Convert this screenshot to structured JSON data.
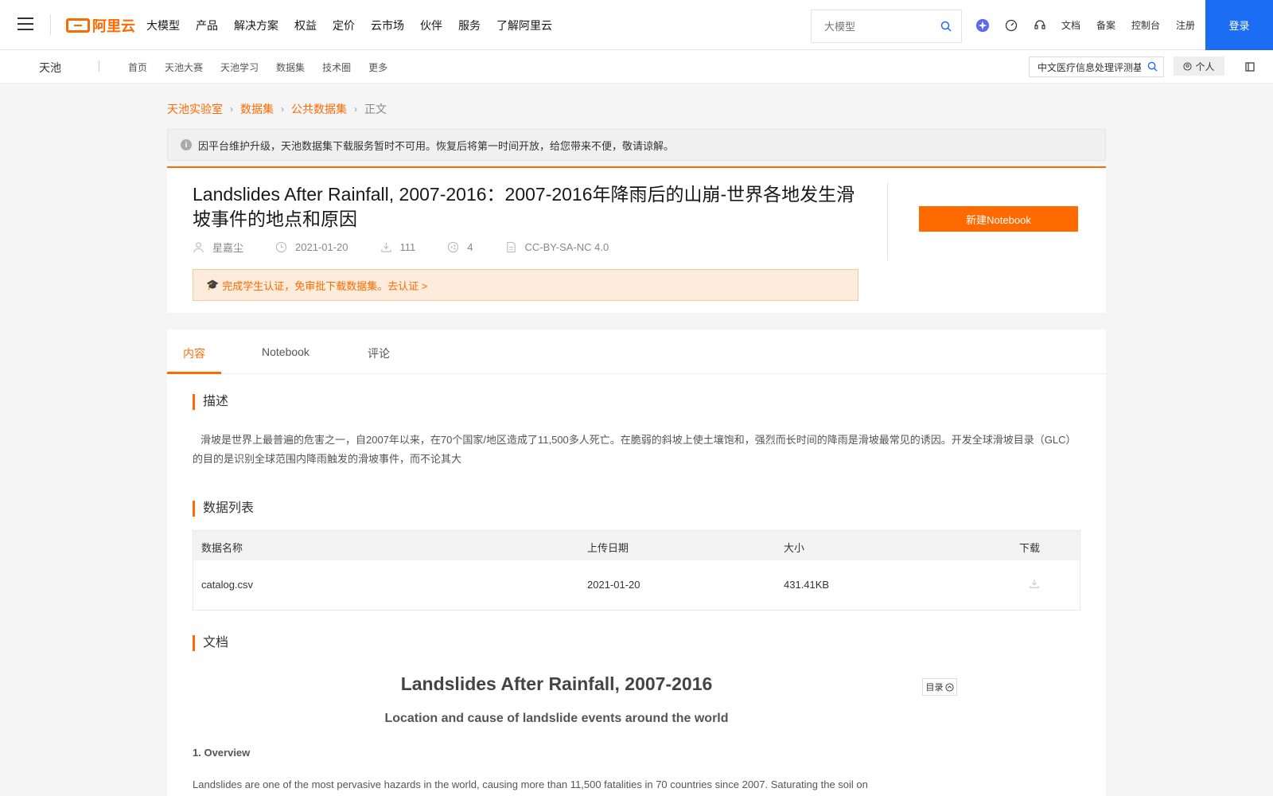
{
  "topnav": {
    "logo_text": "阿里云",
    "menu": [
      "大模型",
      "产品",
      "解决方案",
      "权益",
      "定价",
      "云市场",
      "伙伴",
      "服务",
      "了解阿里云"
    ],
    "search_placeholder": "大模型",
    "links": [
      "文档",
      "备案",
      "控制台",
      "注册"
    ],
    "login": "登录"
  },
  "subnav": {
    "brand": "天池",
    "items": [
      "首页",
      "天池大赛",
      "天池学习",
      "数据集",
      "技术圈",
      "更多"
    ],
    "search_value": "中文医疗信息处理评测基",
    "personal": "个人"
  },
  "breadcrumb": [
    "天池实验室",
    "数据集",
    "公共数据集",
    "正文"
  ],
  "notice": "因平台维护升级，天池数据集下载服务暂时不可用。恢复后将第一时间开放，给您带来不便，敬请谅解。",
  "dataset": {
    "title": "Landslides After Rainfall, 2007-2016：2007-2016年降雨后的山崩-世界各地发生滑坡事件的地点和原因",
    "author": "星嘉尘",
    "date": "2021-01-20",
    "downloads": "111",
    "shares": "4",
    "license": "CC-BY-SA-NC 4.0",
    "student_banner": "完成学生认证，免审批下载数据集。去认证 >",
    "new_notebook": "新建Notebook"
  },
  "tabs": [
    "内容",
    "Notebook",
    "评论"
  ],
  "sections": {
    "description_title": "描述",
    "description": "滑坡是世界上最普遍的危害之一，自2007年以来，在70个国家/地区造成了11,500多人死亡。在脆弱的斜坡上使土壤饱和，强烈而长时间的降雨是滑坡最常见的诱因。开发全球滑坡目录（GLC）的目的是识别全球范围内降雨触发的滑坡事件，而不论其大",
    "datalist_title": "数据列表",
    "docs_title": "文档"
  },
  "table": {
    "headers": [
      "数据名称",
      "上传日期",
      "大小",
      "下载"
    ],
    "rows": [
      {
        "name": "catalog.csv",
        "date": "2021-01-20",
        "size": "431.41KB"
      }
    ]
  },
  "doc": {
    "title": "Landslides After Rainfall, 2007-2016",
    "subtitle": "Location and cause of landslide events around the world",
    "toc": "目录",
    "h1": "1. Overview",
    "p1": "Landslides are one of the most pervasive hazards in the world, causing more than 11,500 fatalities in 70 countries since 2007. Saturating the soil on"
  },
  "colors": {
    "accent": "#ff6a00",
    "primary_blue": "#1b6ef3"
  }
}
